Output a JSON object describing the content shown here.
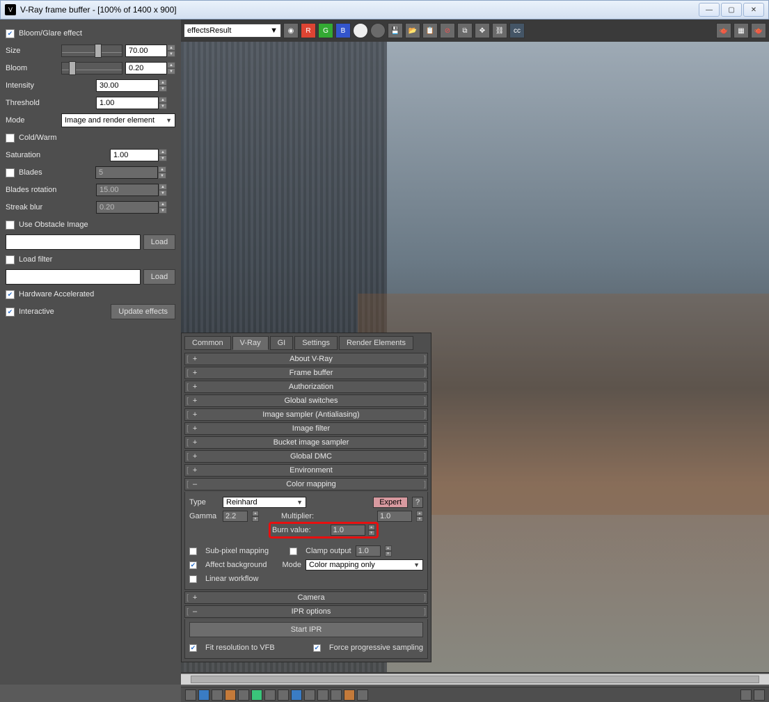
{
  "window": {
    "title": "V-Ray frame buffer - [100% of 1400 x 900]"
  },
  "left": {
    "bloom_glare": "Bloom/Glare effect",
    "size_label": "Size",
    "size_val": "70.00",
    "bloom_label": "Bloom",
    "bloom_val": "0.20",
    "intensity_label": "Intensity",
    "intensity_val": "30.00",
    "threshold_label": "Threshold",
    "threshold_val": "1.00",
    "mode_label": "Mode",
    "mode_val": "Image and render element",
    "coldwarm": "Cold/Warm",
    "saturation_label": "Saturation",
    "saturation_val": "1.00",
    "blades_label": "Blades",
    "blades_val": "5",
    "blades_rot_label": "Blades rotation",
    "blades_rot_val": "15.00",
    "streak_label": "Streak blur",
    "streak_val": "0.20",
    "obstacle": "Use Obstacle Image",
    "load": "Load",
    "loadfilter": "Load filter",
    "hw": "Hardware Accelerated",
    "interactive": "Interactive",
    "update": "Update effects"
  },
  "toolbar": {
    "channel": "effectsResult",
    "r": "R",
    "g": "G",
    "b": "B"
  },
  "tabs": {
    "common": "Common",
    "vray": "V-Ray",
    "gi": "GI",
    "settings": "Settings",
    "elements": "Render Elements"
  },
  "rollouts": {
    "about": "About V-Ray",
    "fb": "Frame buffer",
    "auth": "Authorization",
    "globals": "Global switches",
    "sampler": "Image sampler (Antialiasing)",
    "filter": "Image filter",
    "bucket": "Bucket image sampler",
    "dmc": "Global DMC",
    "env": "Environment",
    "cm": "Color mapping",
    "camera": "Camera",
    "ipr": "IPR options"
  },
  "cm": {
    "type_label": "Type",
    "type_val": "Reinhard",
    "gamma_label": "Gamma",
    "gamma_val": "2.2",
    "multiplier_label": "Multiplier:",
    "multiplier_val": "1.0",
    "burn_label": "Burn value:",
    "burn_val": "1.0",
    "expert": "Expert",
    "q": "?",
    "subpixel": "Sub-pixel mapping",
    "affect": "Affect background",
    "linear": "Linear workflow",
    "clamp": "Clamp output",
    "clamp_val": "1.0",
    "cm_mode_label": "Mode",
    "cm_mode_val": "Color mapping only"
  },
  "ipr": {
    "start": "Start IPR",
    "fit": "Fit resolution to VFB",
    "force": "Force progressive sampling"
  }
}
